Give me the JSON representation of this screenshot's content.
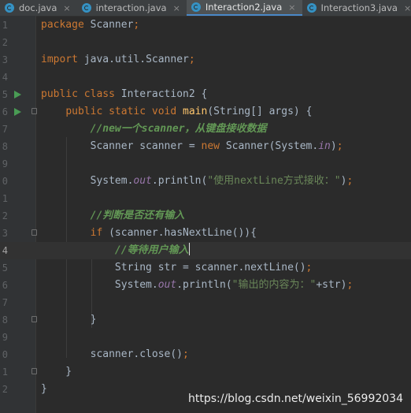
{
  "tabs": [
    {
      "label": "doc.java",
      "active": false
    },
    {
      "label": "interaction.java",
      "active": false
    },
    {
      "label": "Interaction2.java",
      "active": true
    },
    {
      "label": "Interaction3.java",
      "active": false
    }
  ],
  "close_glyph": "×",
  "lines": [
    {
      "number": "1",
      "tokens": [
        [
          "kw",
          "package "
        ],
        [
          "plain",
          "Scanner"
        ],
        [
          "kw",
          ";"
        ]
      ]
    },
    {
      "number": "2",
      "tokens": []
    },
    {
      "number": "3",
      "tokens": [
        [
          "kw",
          "import "
        ],
        [
          "plain",
          "java.util.Scanner"
        ],
        [
          "kw",
          ";"
        ]
      ]
    },
    {
      "number": "4",
      "tokens": []
    },
    {
      "number": "5",
      "tokens": [
        [
          "kw",
          "public class "
        ],
        [
          "plain",
          "Interaction2 {"
        ]
      ],
      "run": true
    },
    {
      "number": "6",
      "tokens": [
        [
          "plain",
          "    "
        ],
        [
          "kw",
          "public static void "
        ],
        [
          "fn",
          "main"
        ],
        [
          "plain",
          "(String[] args) {"
        ]
      ],
      "run": true,
      "fold": true
    },
    {
      "number": "7",
      "tokens": [
        [
          "plain",
          "        "
        ],
        [
          "cm",
          "//new一个scanner，从键盘接收数据"
        ]
      ]
    },
    {
      "number": "8",
      "tokens": [
        [
          "plain",
          "        Scanner scanner = "
        ],
        [
          "kw",
          "new "
        ],
        [
          "plain",
          "Scanner(System."
        ],
        [
          "field",
          "in"
        ],
        [
          "plain",
          ")"
        ],
        [
          "kw",
          ";"
        ]
      ]
    },
    {
      "number": "9",
      "tokens": []
    },
    {
      "number": "0",
      "tokens": [
        [
          "plain",
          "        System."
        ],
        [
          "field",
          "out"
        ],
        [
          "plain",
          ".println("
        ],
        [
          "str",
          "\"使用nextLine方式接收：\""
        ],
        [
          "plain",
          ")"
        ],
        [
          "kw",
          ";"
        ]
      ]
    },
    {
      "number": "1",
      "tokens": []
    },
    {
      "number": "2",
      "tokens": [
        [
          "plain",
          "        "
        ],
        [
          "cm",
          "//判断是否还有输入"
        ]
      ]
    },
    {
      "number": "3",
      "tokens": [
        [
          "plain",
          "        "
        ],
        [
          "kw",
          "if "
        ],
        [
          "plain",
          "(scanner.hasNextLine()){"
        ]
      ],
      "fold": true
    },
    {
      "number": "4",
      "tokens": [
        [
          "plain",
          "            "
        ],
        [
          "cm",
          "//等待用户输入"
        ]
      ],
      "current": true,
      "caret": true
    },
    {
      "number": "5",
      "tokens": [
        [
          "plain",
          "            String str = scanner.nextLine()"
        ],
        [
          "kw",
          ";"
        ]
      ]
    },
    {
      "number": "6",
      "tokens": [
        [
          "plain",
          "            System."
        ],
        [
          "field",
          "out"
        ],
        [
          "plain",
          ".println("
        ],
        [
          "str",
          "\"输出的内容为：\""
        ],
        [
          "plain",
          "+str)"
        ],
        [
          "kw",
          ";"
        ]
      ]
    },
    {
      "number": "7",
      "tokens": []
    },
    {
      "number": "8",
      "tokens": [
        [
          "plain",
          "        }"
        ]
      ],
      "fold": true
    },
    {
      "number": "9",
      "tokens": []
    },
    {
      "number": "0",
      "tokens": [
        [
          "plain",
          "        scanner.close()"
        ],
        [
          "kw",
          ";"
        ]
      ]
    },
    {
      "number": "1",
      "tokens": [
        [
          "plain",
          "    }"
        ]
      ],
      "fold": true
    },
    {
      "number": "2",
      "tokens": [
        [
          "plain",
          "}"
        ]
      ]
    }
  ],
  "watermark": "https://blog.csdn.net/weixin_56992034",
  "colors": {
    "background": "#2b2b2b",
    "keyword": "#cc7832",
    "method": "#ffc66d",
    "string": "#6a8759",
    "field": "#9876aa",
    "comment": "#629755",
    "text": "#a9b7c6",
    "run_icon": "#499c54"
  }
}
